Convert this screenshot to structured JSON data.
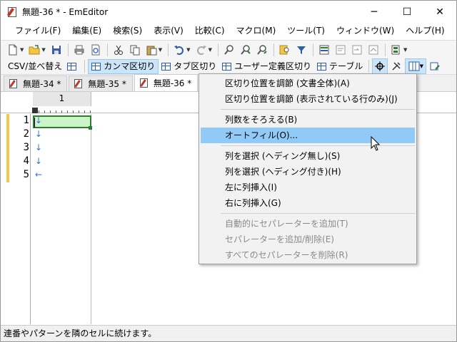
{
  "window": {
    "title": "無題-36 * - EmEditor",
    "minimize_glyph": "─",
    "maximize_glyph": "☐",
    "close_glyph": "✕"
  },
  "menubar": {
    "items": [
      "ファイル(F)",
      "編集(E)",
      "検索(S)",
      "表示(V)",
      "比較(C)",
      "マクロ(M)",
      "ツール(T)",
      "ウィンドウ(W)",
      "ヘルプ(H)"
    ]
  },
  "toolbar1": {
    "icons": [
      "new-file-icon",
      "open-folder-icon",
      "save-icon",
      "print-icon",
      "print-preview-icon",
      "cut-icon",
      "copy-icon",
      "paste-icon",
      "undo-icon",
      "redo-icon",
      "find-icon",
      "find-next-icon",
      "find-prev-icon",
      "find-in-files-icon",
      "filter-icon",
      "outline-icon",
      "wrap-icon",
      "wrap-window-icon",
      "wrap-page-icon",
      "plugin-icon"
    ]
  },
  "toolbar2": {
    "csv_sort_label": "CSV/並べ替え",
    "comma_label": "カンマ区切り",
    "tab_label": "タブ区切り",
    "user_label": "ユーザー定義区切り",
    "table_label": "テーブル"
  },
  "tabs": [
    {
      "label": "無題-34 *",
      "active": false
    },
    {
      "label": "無題-35 *",
      "active": false
    },
    {
      "label": "無題-36 *",
      "active": true
    }
  ],
  "editor": {
    "column_header": "1",
    "line_numbers": [
      "1",
      "2",
      "3",
      "4",
      "5"
    ],
    "eol_marks": [
      "↓",
      "↓",
      "↓",
      "↓",
      "←"
    ]
  },
  "context_menu": {
    "groups": [
      [
        {
          "label": "区切り位置を調節 (文書全体)(A)",
          "disabled": false
        },
        {
          "label": "区切り位置を調節 (表示されている行のみ)(J)",
          "disabled": false
        }
      ],
      [
        {
          "label": "列数をそろえる(B)",
          "disabled": false
        },
        {
          "label": "オートフィル(O)...",
          "disabled": false,
          "highlighted": true
        }
      ],
      [
        {
          "label": "列を選択 (ヘディング無し)(S)",
          "disabled": false
        },
        {
          "label": "列を選択 (ヘディング付き)(H)",
          "disabled": false
        },
        {
          "label": "左に列挿入(I)",
          "disabled": false
        },
        {
          "label": "右に列挿入(G)",
          "disabled": false
        }
      ],
      [
        {
          "label": "自動的にセパレーターを追加(T)",
          "disabled": true
        },
        {
          "label": "セパレーターを追加/削除(E)",
          "disabled": true
        },
        {
          "label": "すべてのセパレーターを削除(R)",
          "disabled": true
        }
      ]
    ]
  },
  "statusbar": {
    "text": "連番やパターンを隣のセルに続けます。"
  },
  "colors": {
    "highlight": "#91c9f7",
    "cell_fill": "#c9f5c9",
    "cell_border": "#2e7d32",
    "change_bar": "#f2c84b",
    "eol_mark": "#3a6fd8"
  }
}
